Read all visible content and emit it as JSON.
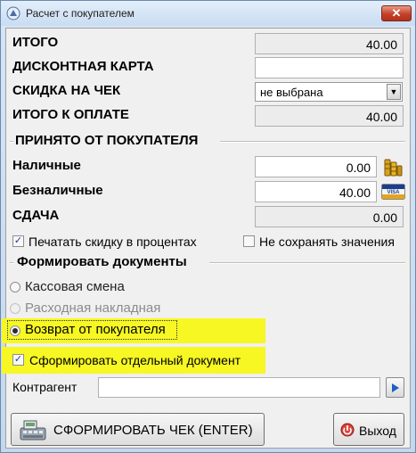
{
  "window": {
    "title": "Расчет с покупателем",
    "close_symbol": "✕"
  },
  "totals": {
    "total_label": "ИТОГО",
    "total_value": "40.00",
    "discount_card_label": "ДИСКОНТНАЯ КАРТА",
    "discount_card_value": "",
    "check_discount_label": "СКИДКА НА ЧЕК",
    "check_discount_value": "не выбрана",
    "payable_label": "ИТОГО К ОПЛАТЕ",
    "payable_value": "40.00"
  },
  "received": {
    "group_label": "ПРИНЯТО ОТ ПОКУПАТЕЛЯ",
    "cash_label": "Наличные",
    "cash_value": "0.00",
    "cashless_label": "Безналичные",
    "cashless_value": "40.00",
    "change_label": "СДАЧА",
    "change_value": "0.00"
  },
  "options": {
    "print_discount_percent": {
      "label": "Печатать скидку в процентах",
      "checked": true
    },
    "do_not_save": {
      "label": "Не сохранять значения",
      "checked": false
    }
  },
  "documents": {
    "group_label": "Формировать документы",
    "items": [
      {
        "label": "Кассовая смена",
        "selected": false,
        "enabled": true
      },
      {
        "label": "Расходная накладная",
        "selected": false,
        "enabled": false
      },
      {
        "label": "Возврат от покупателя",
        "selected": true,
        "enabled": true
      }
    ],
    "separate_doc": {
      "label": "Сформировать отдельный документ",
      "checked": true
    }
  },
  "counterparty": {
    "label": "Контрагент",
    "value": ""
  },
  "buttons": {
    "make_check": "СФОРМИРОВАТЬ ЧЕК (ENTER)",
    "exit": "Выход"
  },
  "colors": {
    "highlight": "#f7f724",
    "title_bar": "#c9dcf1",
    "close_button": "#c5402a"
  }
}
